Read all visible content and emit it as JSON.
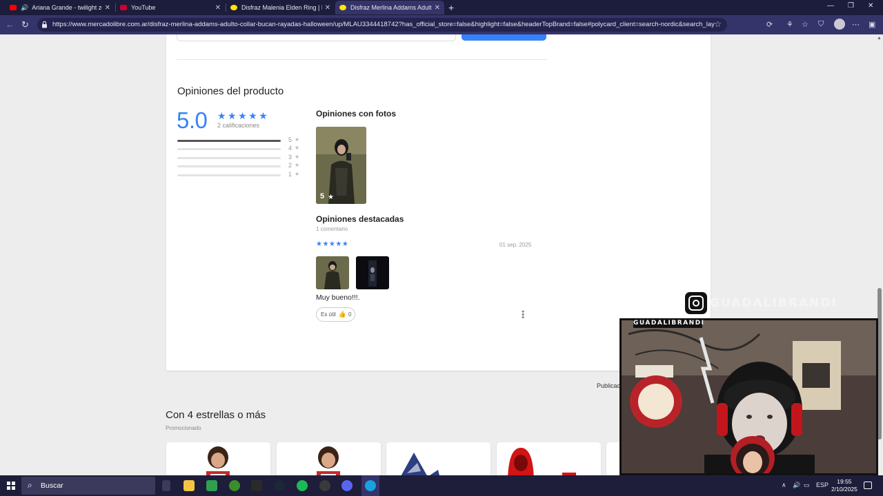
{
  "browser": {
    "tabs": [
      {
        "label": "Ariana Grande - twilight zon",
        "favicon_color": "#ff0000",
        "active": false
      },
      {
        "label": "YouTube",
        "favicon_color": "#cc0033",
        "active": false
      },
      {
        "label": "Disfraz Malenia Elden Ring | Merc",
        "favicon_color": "#ffe600",
        "active": false
      },
      {
        "label": "Disfraz Merlina Addams Adulto C",
        "favicon_color": "#ffe600",
        "active": true
      }
    ],
    "new_tab": "+",
    "url": "https://www.mercadolibre.com.ar/disfraz-merlina-addams-adulto-collar-bucan-rayadas-halloween/up/MLAU3344418742?has_official_store=false&highlight=false&headerTopBrand=false#polycard_client=search-nordic&search_layo..."
  },
  "reviews": {
    "section_title": "Opiniones del producto",
    "average": "5.0",
    "stars": "★★★★★",
    "ratings_count": "2 calificaciones",
    "distribution": [
      {
        "label": "5",
        "fraction": 1.0
      },
      {
        "label": "4",
        "fraction": 0
      },
      {
        "label": "3",
        "fraction": 0
      },
      {
        "label": "2",
        "fraction": 0
      },
      {
        "label": "1",
        "fraction": 0
      }
    ],
    "photos_title": "Opiniones con fotos",
    "photo_rating": "5",
    "featured_title": "Opiniones destacadas",
    "featured_count": "1 comentario",
    "review": {
      "stars": "★★★★★",
      "date": "01 sep. 2025",
      "text": "Muy bueno!!!.",
      "useful_label": "Es útil",
      "useful_count": "0"
    }
  },
  "publication_label": "Publicac",
  "recommendations": {
    "title": "Con 4 estrellas o más",
    "subtitle": "Promocionado"
  },
  "overlay": {
    "instagram_handle": "GUADALIBRANDI",
    "cam_name": "GUADALIBRANDI"
  },
  "taskbar": {
    "search_placeholder": "Buscar",
    "language": "ESP",
    "time": "19:55",
    "date": "2/10/2025"
  },
  "colors": {
    "accent": "#3483fa",
    "tab_bar": "#1c1c3c",
    "address_bar": "#35346a",
    "taskbar": "#1e1d3a"
  }
}
